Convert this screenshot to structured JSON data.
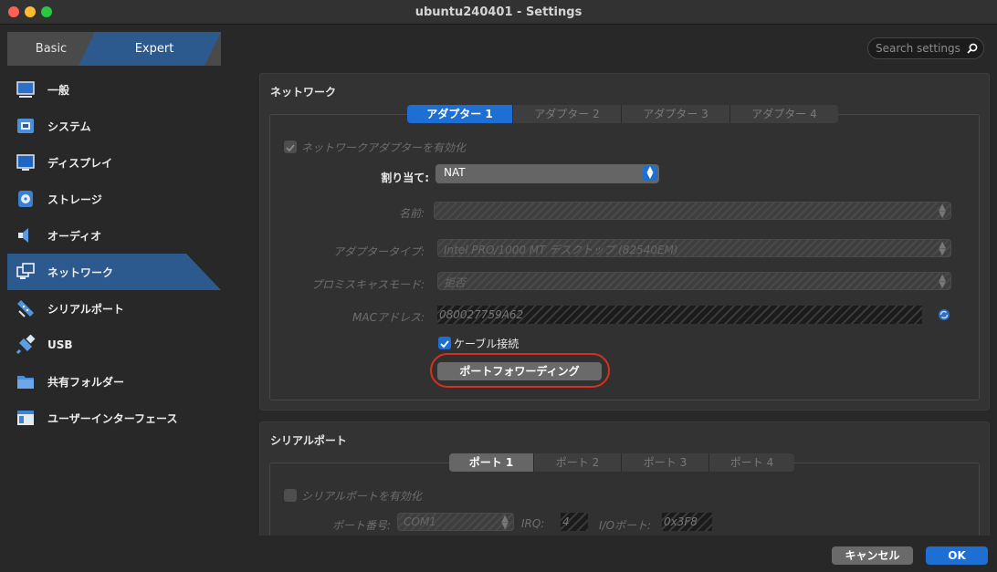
{
  "window": {
    "title": "ubuntu240401 - Settings"
  },
  "colors": {
    "accent": "#1e6fd4",
    "selection": "#2d5a8e",
    "highlight": "#d7301c"
  },
  "mode": {
    "basic": "Basic",
    "expert": "Expert"
  },
  "search": {
    "placeholder": "Search settings"
  },
  "sidebar": {
    "items": [
      {
        "label": "一般",
        "icon": "general-icon"
      },
      {
        "label": "システム",
        "icon": "system-icon"
      },
      {
        "label": "ディスプレイ",
        "icon": "display-icon"
      },
      {
        "label": "ストレージ",
        "icon": "storage-icon"
      },
      {
        "label": "オーディオ",
        "icon": "audio-icon"
      },
      {
        "label": "ネットワーク",
        "icon": "network-icon",
        "selected": true
      },
      {
        "label": "シリアルポート",
        "icon": "serial-port-icon"
      },
      {
        "label": "USB",
        "icon": "usb-icon"
      },
      {
        "label": "共有フォルダー",
        "icon": "shared-folder-icon"
      },
      {
        "label": "ユーザーインターフェース",
        "icon": "user-interface-icon"
      }
    ]
  },
  "network": {
    "title": "ネットワーク",
    "tabs": [
      "アダプター 1",
      "アダプター 2",
      "アダプター 3",
      "アダプター 4"
    ],
    "enable_label": "ネットワークアダプターを有効化",
    "attached_label": "割り当て:",
    "attached_value": "NAT",
    "name_label": "名前:",
    "adapter_type_label": "アダプタータイプ:",
    "adapter_type_value": "Intel PRO/1000 MT デスクトップ (82540EM)",
    "promisc_label": "プロミスキャスモード:",
    "promisc_value": "拒否",
    "mac_label": "MACアドレス:",
    "mac_value": "080027759A62",
    "cable_label": "ケーブル接続",
    "port_forwarding_label": "ポートフォワーディング"
  },
  "serial": {
    "title": "シリアルポート",
    "tabs": [
      "ポート 1",
      "ポート 2",
      "ポート 3",
      "ポート 4"
    ],
    "enable_label": "シリアルポートを有効化",
    "port_number_label": "ポート番号:",
    "port_number_value": "COM1",
    "irq_label": "IRQ:",
    "irq_value": "4",
    "io_port_label": "I/Oポート:",
    "io_port_value": "0x3F8"
  },
  "footer": {
    "cancel": "キャンセル",
    "ok": "OK"
  }
}
